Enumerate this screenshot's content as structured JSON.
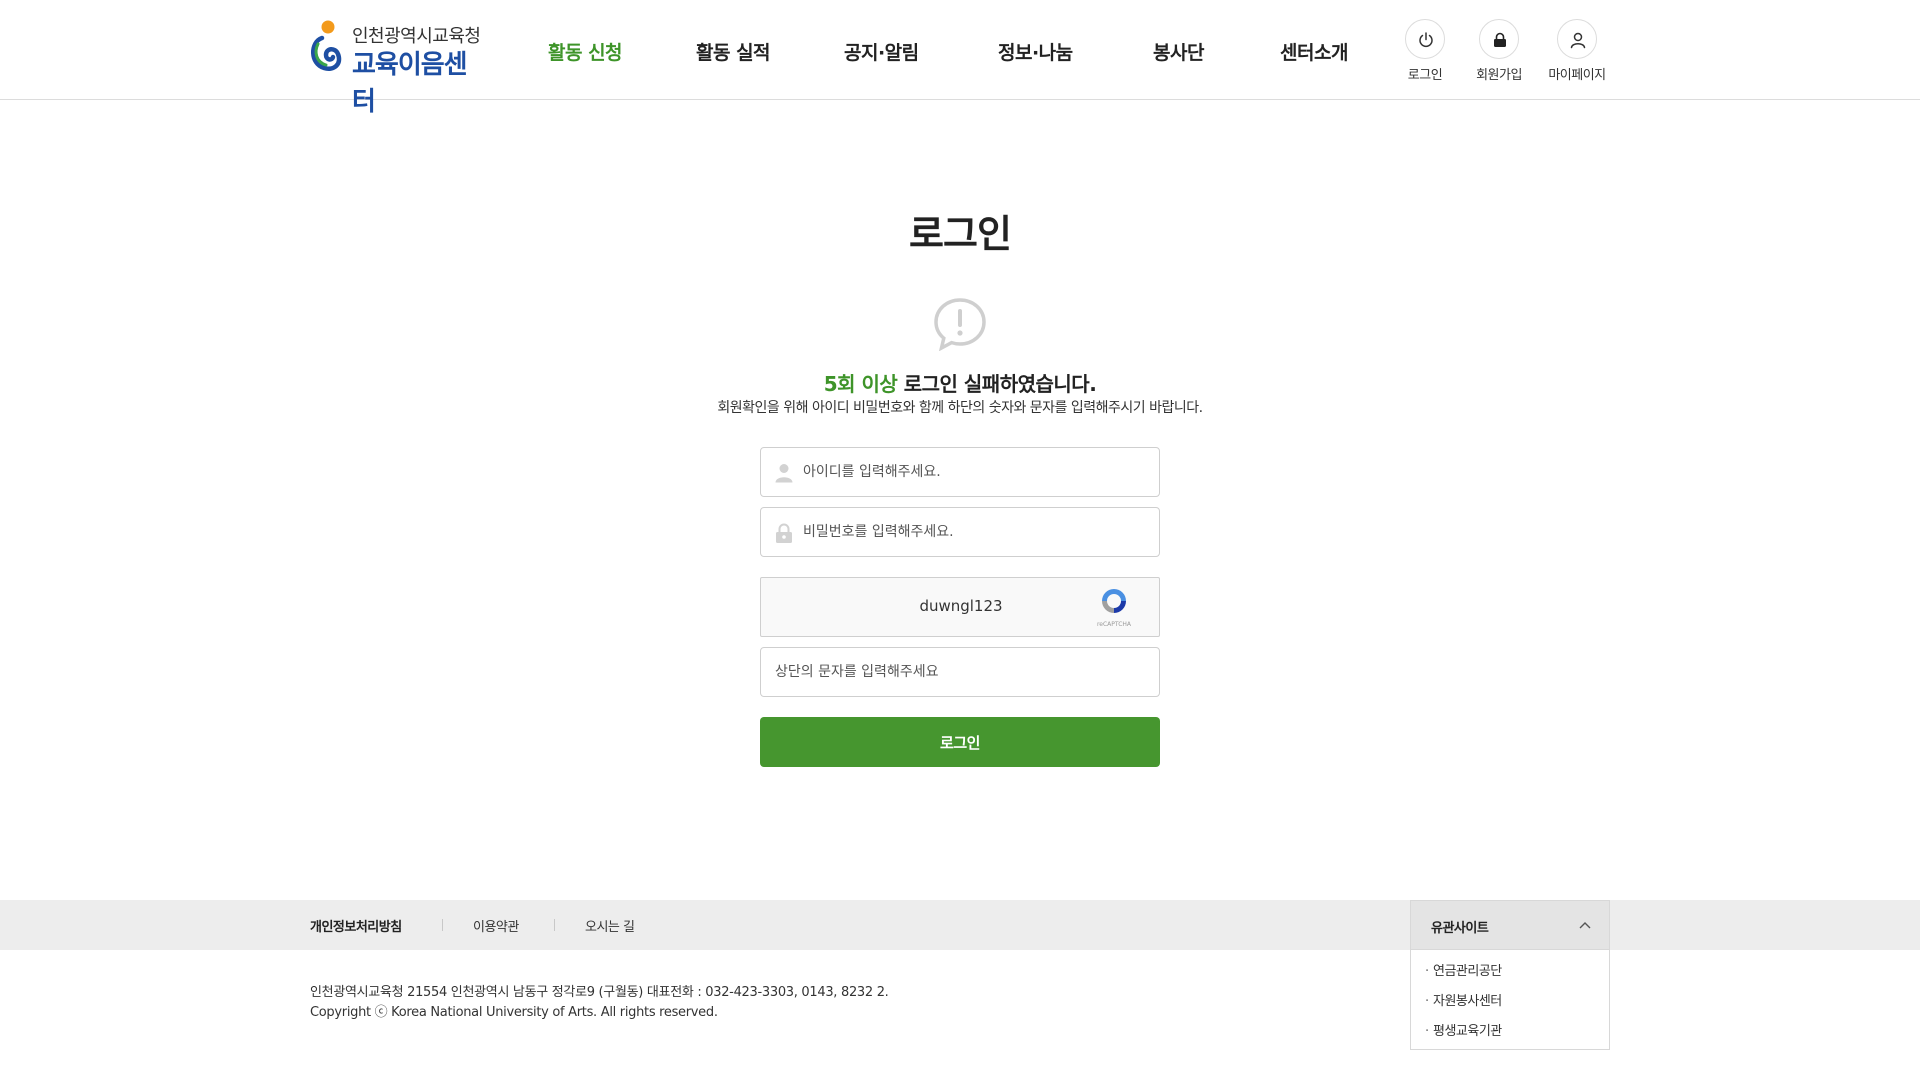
{
  "header": {
    "logo": {
      "line1": "인천광역시교육청",
      "line2": "교육이음센터"
    },
    "nav": [
      {
        "label": "활동 신청",
        "active": true
      },
      {
        "label": "활동 실적",
        "active": false
      },
      {
        "label": "공지·알림",
        "active": false
      },
      {
        "label": "정보·나눔",
        "active": false
      },
      {
        "label": "봉사단",
        "active": false
      },
      {
        "label": "센터소개",
        "active": false
      }
    ],
    "util": [
      {
        "label": "로그인",
        "icon": "power-icon"
      },
      {
        "label": "회원가입",
        "icon": "lock-icon"
      },
      {
        "label": "마이페이지",
        "icon": "user-icon"
      }
    ]
  },
  "main": {
    "title": "로그인",
    "fail": {
      "highlight": "5회 이상",
      "rest": " 로그인 실패하였습니다."
    },
    "description": "회원확인을 위해 아이디 비밀번호와 함께 하단의 숫자와 문자를 입력해주시기 바랍니다.",
    "id_placeholder": "아이디를 입력해주세요.",
    "pw_placeholder": "비밀번호를 입력해주세요.",
    "captcha": {
      "code": "duwngl123",
      "badge": "reCAPTCHA"
    },
    "captcha_placeholder": "상단의 문자를 입력해주세요",
    "login_button": "로그인"
  },
  "footer": {
    "links": [
      "개인정보처리방침",
      "이용약관",
      "오시는 길"
    ],
    "family_label": "유관사이트",
    "family_sites": [
      "연금관리공단",
      "자원봉사센터",
      "평생교육기관"
    ],
    "address": "인천광역시교육청 21554 인천광역시 남동구 정각로9 (구월동) 대표전화 : 032-423-3303, 0143, 8232 2.",
    "copyright": "Copyright ⓒ Korea National University of Arts. All rights reserved."
  },
  "colors": {
    "accent": "#46962f",
    "accent_text": "#3e9429",
    "logo_blue": "#1e4fa3",
    "logo_orange": "#f39a1b",
    "footer_bg": "#ededed"
  }
}
